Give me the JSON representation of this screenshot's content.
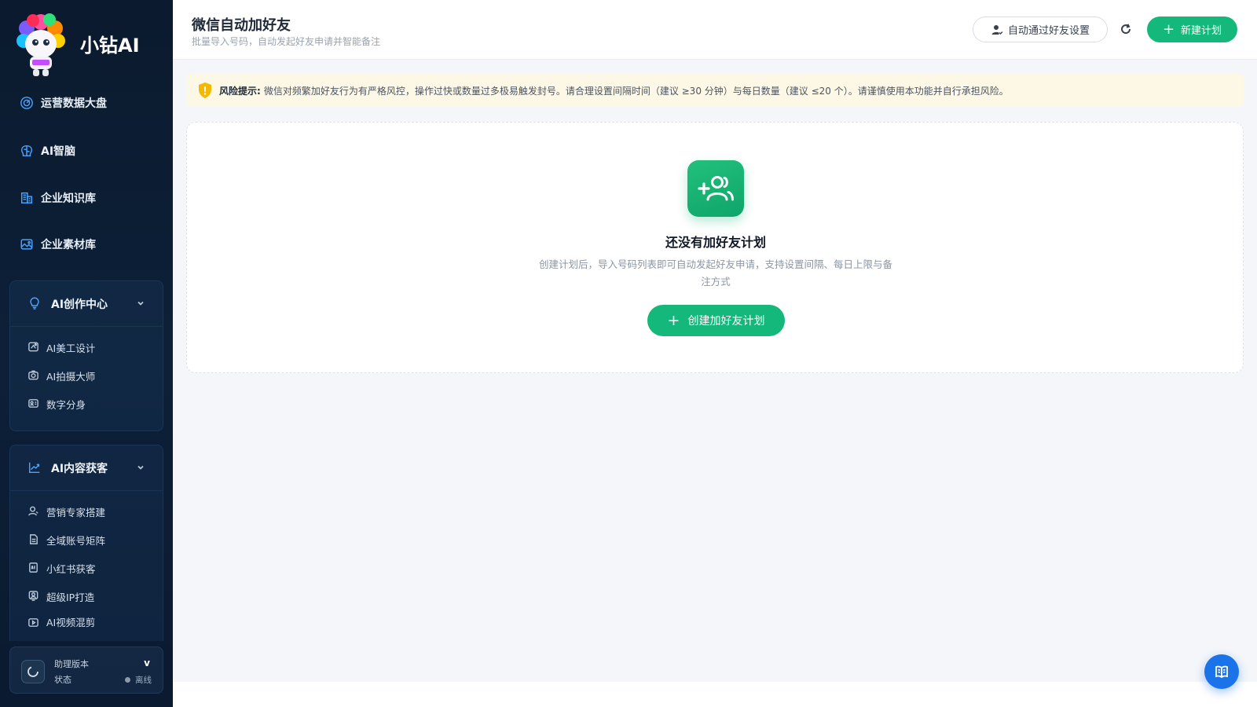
{
  "brand": {
    "name": "小钻AI",
    "badge": "小钻AI"
  },
  "nav": [
    {
      "label": "运营数据大盘",
      "icon": "dashboard-icon"
    },
    {
      "label": "AI智脑",
      "icon": "brain-icon"
    },
    {
      "label": "企业知识库",
      "icon": "building-icon"
    },
    {
      "label": "企业素材库",
      "icon": "image-icon"
    }
  ],
  "groups": {
    "creation": {
      "label": "AI创作中心",
      "items": [
        {
          "label": "AI美工设计"
        },
        {
          "label": "AI拍摄大师"
        },
        {
          "label": "数字分身"
        }
      ]
    },
    "content": {
      "label": "AI内容获客",
      "items": [
        {
          "label": "营销专家搭建"
        },
        {
          "label": "全域账号矩阵"
        },
        {
          "label": "小红书获客"
        },
        {
          "label": "超级IP打造"
        },
        {
          "label": "AI视频混剪"
        }
      ]
    }
  },
  "assistant": {
    "version_label": "助理版本",
    "version": "v",
    "status_label": "状态",
    "status": "离线"
  },
  "header": {
    "title": "微信自动加好友",
    "subtitle": "批量导入号码，自动发起好友申请并智能备注",
    "auto_accept_label": "自动通过好友设置",
    "new_plan_label": "新建计划"
  },
  "alert": {
    "label": "风险提示:",
    "text": "微信对频繁加好友行为有严格风控，操作过快或数量过多极易触发封号。请合理设置间隔时间（建议 ≥30 分钟）与每日数量（建议 ≤20 个）。请谨慎使用本功能并自行承担风险。"
  },
  "empty": {
    "title": "还没有加好友计划",
    "desc": "创建计划后，导入号码列表即可自动发起好友申请，支持设置间隔、每日上限与备注方式",
    "cta": "创建加好友计划"
  },
  "colors": {
    "primary": "#14b87a",
    "sidebar": "#0b1a2e",
    "accent_blue": "#1a73e8",
    "warning_bg": "#fdf7e6",
    "warning_icon": "#f5b800"
  }
}
